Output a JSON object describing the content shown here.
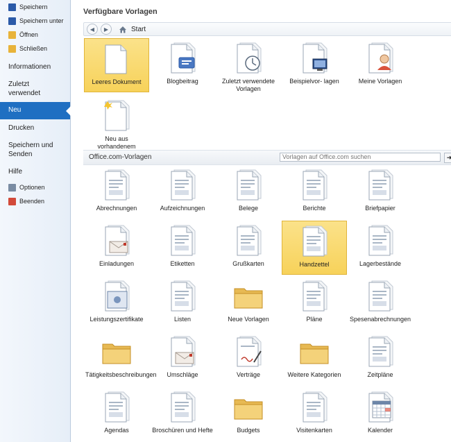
{
  "sidebar": {
    "commands": [
      {
        "label": "Speichern",
        "icon": "save-icon",
        "color": "#2b5aa8"
      },
      {
        "label": "Speichern unter",
        "icon": "save-as-icon",
        "color": "#2b5aa8"
      },
      {
        "label": "Öffnen",
        "icon": "open-folder-icon",
        "color": "#e8b33a"
      },
      {
        "label": "Schließen",
        "icon": "close-folder-icon",
        "color": "#e8b33a"
      }
    ],
    "tabs": [
      "Informationen",
      "Zuletzt verwendet",
      "Neu",
      "Drucken",
      "Speichern und Senden",
      "Hilfe"
    ],
    "options": [
      {
        "label": "Optionen",
        "icon": "options-icon",
        "color": "#7a8ca3"
      },
      {
        "label": "Beenden",
        "icon": "exit-icon",
        "color": "#d24a3a"
      }
    ]
  },
  "main": {
    "title": "Verfügbare Vorlagen",
    "nav": {
      "back": "◀",
      "forward": "▶",
      "location": "Start"
    },
    "available": [
      {
        "label": "Leeres Dokument",
        "icon": "blank-document-icon"
      },
      {
        "label": "Blogbeitrag",
        "icon": "blog-post-icon"
      },
      {
        "label": "Zuletzt verwendete Vorlagen",
        "icon": "recent-templates-icon"
      },
      {
        "label": "Beispielvor- lagen",
        "icon": "sample-templates-icon"
      },
      {
        "label": "Meine Vorlagen",
        "icon": "my-templates-icon"
      },
      {
        "label": "Neu aus vorhandenem",
        "icon": "new-from-existing-icon"
      }
    ],
    "office": {
      "label": "Office.com-Vorlagen",
      "search_placeholder": "Vorlagen auf Office.com suchen",
      "go": "➜",
      "items": [
        {
          "label": "Abrechnungen",
          "icon": "document-icon"
        },
        {
          "label": "Aufzeichnungen",
          "icon": "document-icon"
        },
        {
          "label": "Belege",
          "icon": "document-icon"
        },
        {
          "label": "Berichte",
          "icon": "document-icon"
        },
        {
          "label": "Briefpapier",
          "icon": "document-icon"
        },
        {
          "label": "Einladungen",
          "icon": "envelope-icon"
        },
        {
          "label": "Etiketten",
          "icon": "document-icon"
        },
        {
          "label": "Grußkarten",
          "icon": "document-icon"
        },
        {
          "label": "Handzettel",
          "icon": "document-icon"
        },
        {
          "label": "Lagerbestände",
          "icon": "document-icon"
        },
        {
          "label": "Leistungszertifikate",
          "icon": "certificate-icon"
        },
        {
          "label": "Listen",
          "icon": "document-icon"
        },
        {
          "label": "Neue Vorlagen",
          "icon": "folder-icon"
        },
        {
          "label": "Pläne",
          "icon": "document-icon"
        },
        {
          "label": "Spesenabrechnungen",
          "icon": "document-icon"
        },
        {
          "label": "Tätigkeitsbeschreibungen",
          "icon": "folder-icon"
        },
        {
          "label": "Umschläge",
          "icon": "envelope-icon"
        },
        {
          "label": "Verträge",
          "icon": "signature-icon"
        },
        {
          "label": "Weitere Kategorien",
          "icon": "folder-icon"
        },
        {
          "label": "Zeitpläne",
          "icon": "document-icon"
        },
        {
          "label": "Agendas",
          "icon": "document-icon"
        },
        {
          "label": "Broschüren und Hefte",
          "icon": "document-icon"
        },
        {
          "label": "Budgets",
          "icon": "folder-icon"
        },
        {
          "label": "Visitenkarten",
          "icon": "document-icon"
        },
        {
          "label": "Kalender",
          "icon": "calendar-icon"
        }
      ]
    }
  },
  "colors": {
    "accent": "#1f6fc2",
    "selection": "#f7d25a"
  }
}
